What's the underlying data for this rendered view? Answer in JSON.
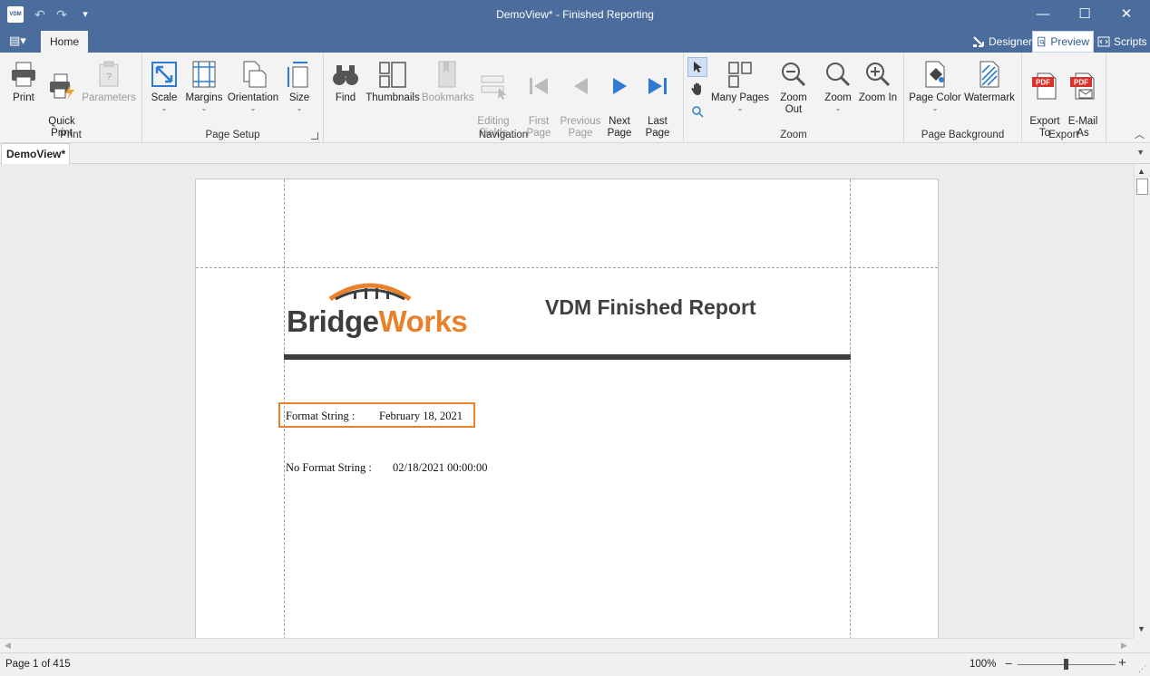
{
  "window": {
    "title": "DemoView* - Finished Reporting",
    "app_logo": "VDM",
    "controls": {
      "minimize": "—",
      "maximize": "☐",
      "close": "✕"
    }
  },
  "quick_access": {
    "undo": "↶",
    "redo": "↷",
    "customize": "▾"
  },
  "ribbon": {
    "file_menu_icon": "▤▾",
    "tabs": [
      {
        "label": "Home",
        "active": true
      }
    ],
    "modes": [
      {
        "label": "Designer",
        "icon": "designer-icon"
      },
      {
        "label": "Preview",
        "icon": "preview-icon",
        "active": true
      },
      {
        "label": "Scripts",
        "icon": "scripts-icon"
      }
    ],
    "groups": {
      "print": {
        "label": "Print",
        "buttons": [
          {
            "label": "Print",
            "icon": "printer-icon"
          },
          {
            "label": "Quick\nPrint",
            "icon": "quick-print-icon"
          },
          {
            "label": "Parameters",
            "icon": "parameters-icon",
            "disabled": true
          }
        ]
      },
      "page_setup": {
        "label": "Page Setup",
        "buttons": [
          {
            "label": "Scale",
            "icon": "scale-icon"
          },
          {
            "label": "Margins",
            "icon": "margins-icon"
          },
          {
            "label": "Orientation",
            "icon": "orientation-icon"
          },
          {
            "label": "Size",
            "icon": "size-icon"
          }
        ]
      },
      "navigation": {
        "label": "Navigation",
        "buttons": [
          {
            "label": "Find",
            "icon": "binoculars-icon"
          },
          {
            "label": "Thumbnails",
            "icon": "thumbnails-icon"
          },
          {
            "label": "Bookmarks",
            "icon": "bookmark-icon",
            "disabled": true
          },
          {
            "label": "Editing\nFields",
            "icon": "editing-fields-icon",
            "disabled": true
          },
          {
            "label": "First\nPage",
            "icon": "first-page-icon",
            "disabled": true
          },
          {
            "label": "Previous\nPage",
            "icon": "previous-page-icon",
            "disabled": true
          },
          {
            "label": "Next\nPage",
            "icon": "next-page-icon"
          },
          {
            "label": "Last\nPage",
            "icon": "last-page-icon"
          }
        ]
      },
      "zoom": {
        "label": "Zoom",
        "buttons": [
          {
            "label": "Many Pages",
            "icon": "many-pages-icon"
          },
          {
            "label": "Zoom Out",
            "icon": "zoom-out-icon"
          },
          {
            "label": "Zoom",
            "icon": "zoom-icon"
          },
          {
            "label": "Zoom In",
            "icon": "zoom-in-icon"
          }
        ]
      },
      "page_background": {
        "label": "Page Background",
        "buttons": [
          {
            "label": "Page Color",
            "icon": "page-color-icon"
          },
          {
            "label": "Watermark",
            "icon": "watermark-icon"
          }
        ]
      },
      "export": {
        "label": "Export",
        "buttons": [
          {
            "label": "Export\nTo",
            "icon": "export-pdf-icon"
          },
          {
            "label": "E-Mail\nAs",
            "icon": "email-pdf-icon"
          }
        ]
      }
    }
  },
  "document_tab": {
    "label": "DemoView*"
  },
  "report": {
    "logo_bridge": "Bridge",
    "logo_works": "Works",
    "title": "VDM Finished Report",
    "format_label": "Format String :",
    "format_value": "February 18, 2021",
    "noformat_label": "No Format String :",
    "noformat_value": "02/18/2021 00:00:00"
  },
  "status": {
    "page_info": "Page 1 of 415",
    "zoom_percent": "100%",
    "zoom_minus": "−",
    "zoom_plus": "+"
  },
  "colors": {
    "title_bar": "#4b6d9e",
    "accent_orange": "#e8822a",
    "nav_blue": "#2f7ad4"
  }
}
